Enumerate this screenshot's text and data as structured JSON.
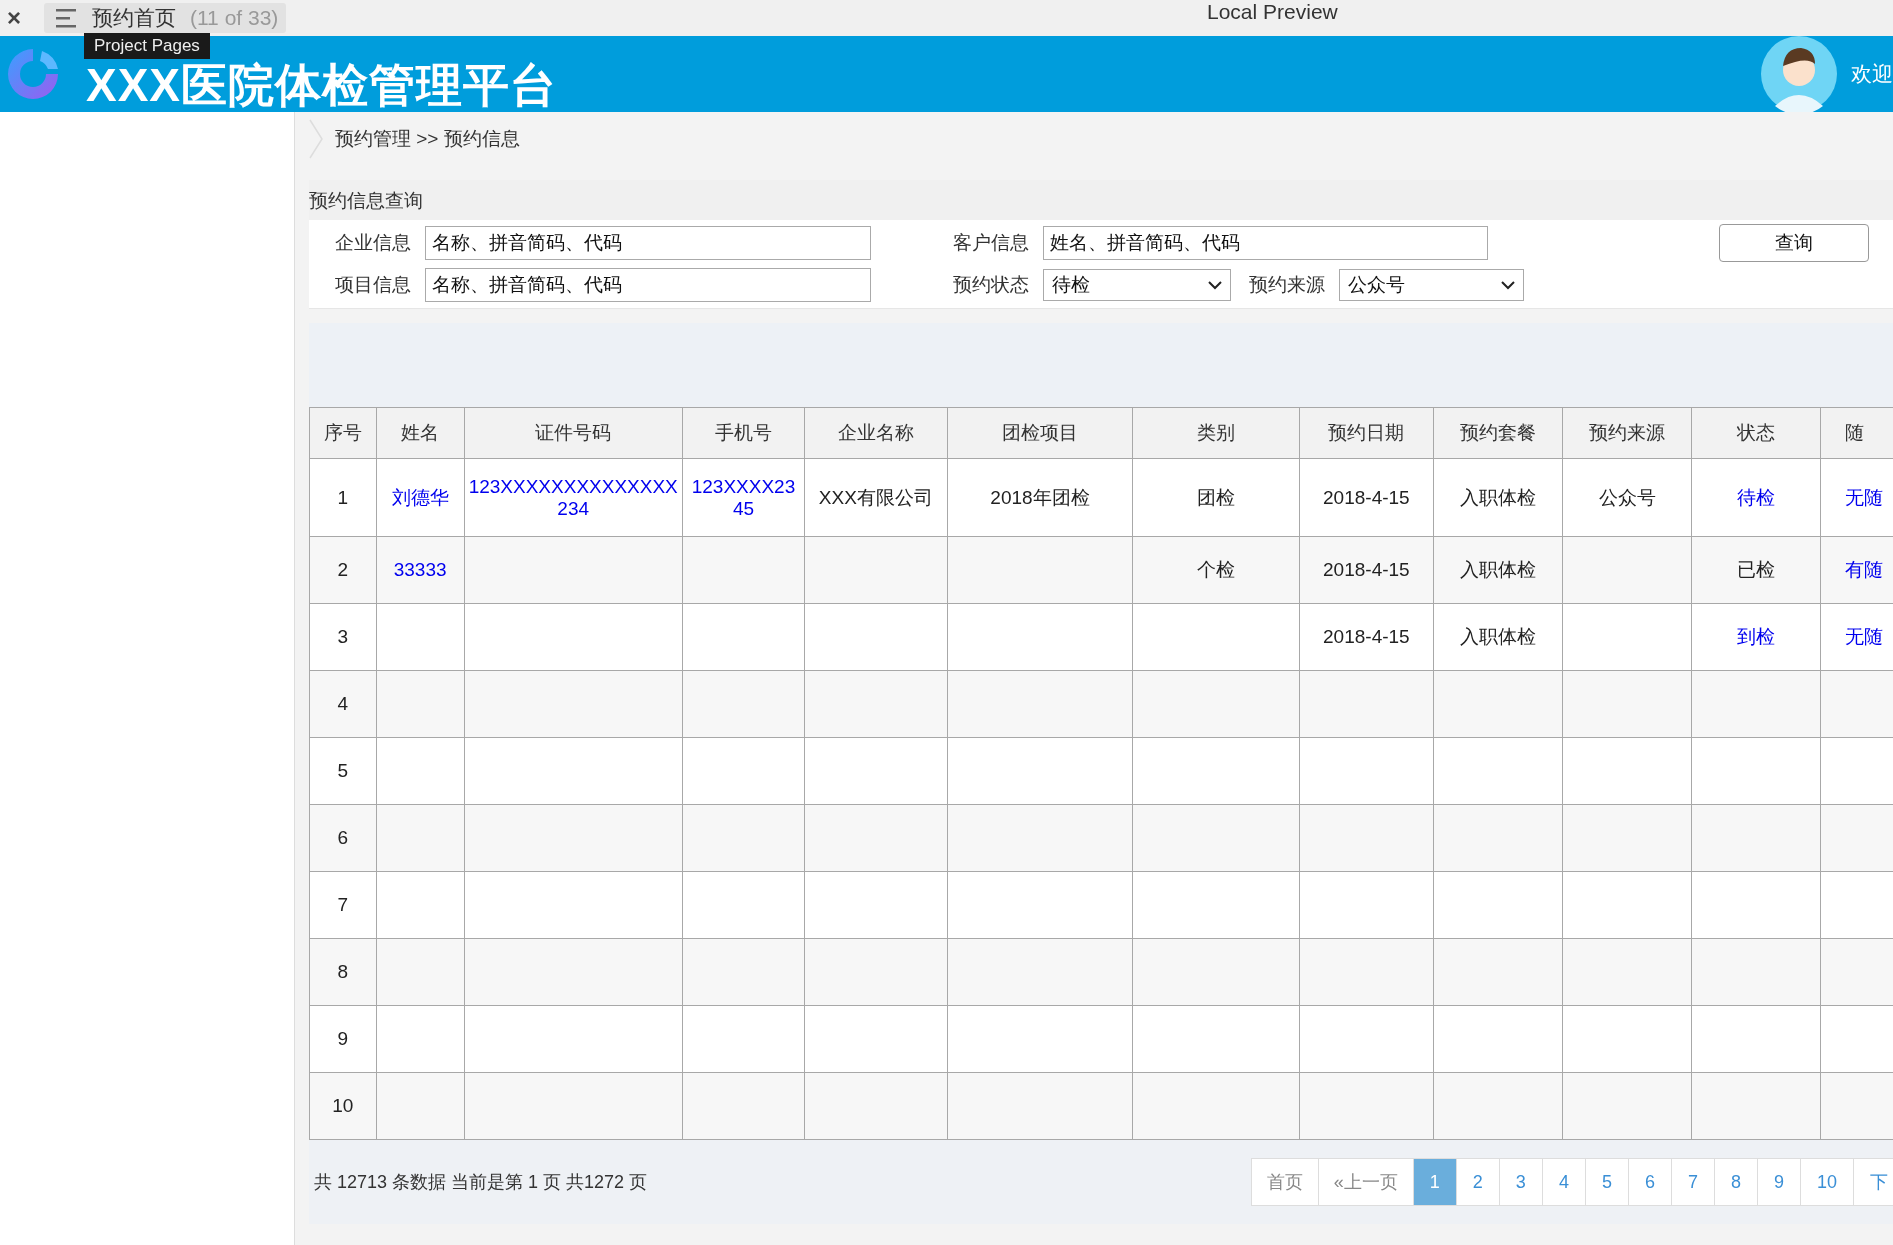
{
  "viewer_bar": {
    "close": "×",
    "page_title": "预约首页",
    "page_count": "(11 of 33)",
    "window_title": "Local Preview",
    "tooltip": "Project Pages"
  },
  "header": {
    "title": "XXX医院体检管理平台",
    "welcome": "欢迎"
  },
  "breadcrumb": "预约管理 >> 预约信息",
  "search": {
    "title": "预约信息查询",
    "fields": [
      {
        "kind": "text",
        "label": "企业信息",
        "value": "名称、拼音简码、代码"
      },
      {
        "kind": "text",
        "label": "客户信息",
        "value": "姓名、拼音简码、代码"
      },
      {
        "kind": "text",
        "label": "项目信息",
        "value": "名称、拼音简码、代码"
      },
      {
        "kind": "select",
        "label": "预约状态",
        "value": "待检"
      },
      {
        "kind": "select",
        "label": "预约来源",
        "value": "公众号"
      }
    ],
    "button": "查询"
  },
  "table": {
    "columns": [
      "序号",
      "姓名",
      "证件号码",
      "手机号",
      "企业名称",
      "团检项目",
      "类别",
      "预约日期",
      "预约套餐",
      "预约来源",
      "状态",
      "随"
    ],
    "rows": [
      {
        "no": "1",
        "name": "刘德华",
        "id_number": "123XXXXXXXXXXXXXX234",
        "phone": "123XXXX2345",
        "company": "XXX有限公司",
        "group_project": "2018年团检",
        "category": "团检",
        "date": "2018-4-15",
        "package": "入职体检",
        "source": "公众号",
        "status": "待检",
        "status_link": true,
        "column_12": "无随"
      },
      {
        "no": "2",
        "name": "33333",
        "category": "个检",
        "date": "2018-4-15",
        "package": "入职体检",
        "status": "已检",
        "status_link": false,
        "column_12": "有随"
      },
      {
        "no": "3",
        "date": "2018-4-15",
        "package": "入职体检",
        "status": "到检",
        "status_link": true,
        "column_12": "无随"
      },
      {
        "no": "4"
      },
      {
        "no": "5"
      },
      {
        "no": "6"
      },
      {
        "no": "7"
      },
      {
        "no": "8"
      },
      {
        "no": "9"
      },
      {
        "no": "10"
      }
    ]
  },
  "pagination": {
    "summary": "共 12713 条数据 当前是第 1 页 共1272 页",
    "first": "首页",
    "prev": "«上一页",
    "pages": [
      {
        "label": "1",
        "selected": true
      },
      {
        "label": "2",
        "selected": false
      },
      {
        "label": "3",
        "selected": false
      },
      {
        "label": "4",
        "selected": false
      },
      {
        "label": "5",
        "selected": false
      },
      {
        "label": "6",
        "selected": false
      },
      {
        "label": "7",
        "selected": false
      },
      {
        "label": "8",
        "selected": false
      },
      {
        "label": "9",
        "selected": false
      },
      {
        "label": "10",
        "selected": false
      }
    ],
    "next": "下"
  }
}
